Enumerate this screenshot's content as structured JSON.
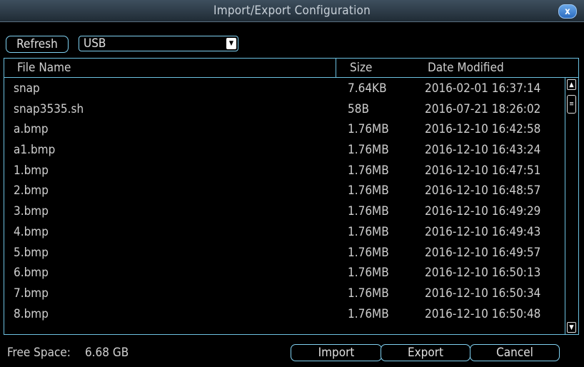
{
  "window": {
    "title": "Import/Export Configuration",
    "close_label": "x"
  },
  "toolbar": {
    "refresh_label": "Refresh",
    "device_value": "USB"
  },
  "table": {
    "headers": {
      "name": "File Name",
      "size": "Size",
      "date": "Date Modified"
    },
    "rows": [
      {
        "name": "snap",
        "size": "7.64KB",
        "date": "2016-02-01 16:37:14"
      },
      {
        "name": "snap3535.sh",
        "size": "58B",
        "date": "2016-07-21 18:26:02"
      },
      {
        "name": "a.bmp",
        "size": "1.76MB",
        "date": "2016-12-10 16:42:58"
      },
      {
        "name": "a1.bmp",
        "size": "1.76MB",
        "date": "2016-12-10 16:43:24"
      },
      {
        "name": "1.bmp",
        "size": "1.76MB",
        "date": "2016-12-10 16:47:51"
      },
      {
        "name": "2.bmp",
        "size": "1.76MB",
        "date": "2016-12-10 16:48:57"
      },
      {
        "name": "3.bmp",
        "size": "1.76MB",
        "date": "2016-12-10 16:49:29"
      },
      {
        "name": "4.bmp",
        "size": "1.76MB",
        "date": "2016-12-10 16:49:43"
      },
      {
        "name": "5.bmp",
        "size": "1.76MB",
        "date": "2016-12-10 16:49:57"
      },
      {
        "name": "6.bmp",
        "size": "1.76MB",
        "date": "2016-12-10 16:50:13"
      },
      {
        "name": "7.bmp",
        "size": "1.76MB",
        "date": "2016-12-10 16:50:34"
      },
      {
        "name": "8.bmp",
        "size": "1.76MB",
        "date": "2016-12-10 16:50:48"
      }
    ]
  },
  "footer": {
    "free_space_label": "Free Space:",
    "free_space_value": "6.68 GB",
    "import_label": "Import",
    "export_label": "Export",
    "cancel_label": "Cancel"
  },
  "colors": {
    "accent_border": "#7fd0f0",
    "background": "#000000",
    "close_button": "#2c6cc0"
  },
  "icons": {
    "close": "close-icon",
    "dropdown": "chevron-down-icon",
    "scroll_up": "arrow-up-icon",
    "scroll_down": "arrow-down-icon"
  }
}
